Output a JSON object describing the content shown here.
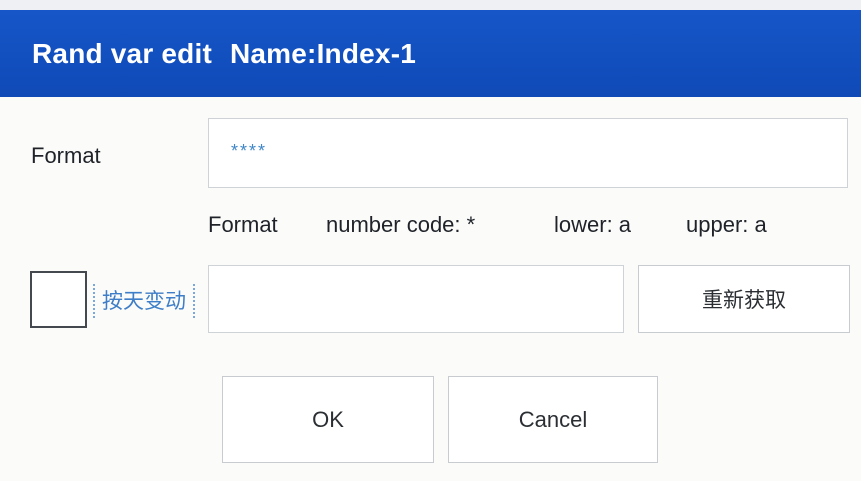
{
  "dialog": {
    "title": "Rand var edit",
    "name": "Name:Index-1"
  },
  "format": {
    "label": "Format",
    "placeholder": "****",
    "hint_label": "Format",
    "hint_number": "number code: *",
    "hint_lower": "lower: a",
    "hint_upper": "upper: a"
  },
  "daily_change": {
    "checked": false,
    "label": "按天变动"
  },
  "result": {
    "value": "",
    "refresh_label": "重新获取"
  },
  "buttons": {
    "ok": "OK",
    "cancel": "Cancel"
  },
  "colors": {
    "title_bar": "#0f4ab7",
    "accent_text": "#3e7ec8",
    "background": "#fbfbf9"
  }
}
